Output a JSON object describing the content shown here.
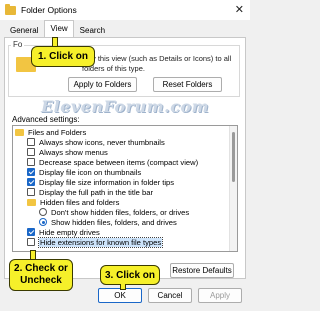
{
  "window": {
    "title": "Folder Options",
    "close_glyph": "✕"
  },
  "tabs": [
    {
      "label": "General",
      "active": false
    },
    {
      "label": "View",
      "active": true
    },
    {
      "label": "Search",
      "active": false
    }
  ],
  "folder_views": {
    "legend": "Fo",
    "description": "pply this view (such as Details or Icons) to all folders of this type.",
    "apply_button": "Apply to Folders",
    "reset_button": "Reset Folders"
  },
  "watermark": "ElevenForum.com",
  "advanced": {
    "label": "Advanced settings:",
    "items": [
      {
        "kind": "folder",
        "label": "Files and Folders",
        "indent": 0
      },
      {
        "kind": "checkbox",
        "label": "Always show icons, never thumbnails",
        "checked": false,
        "indent": 1
      },
      {
        "kind": "checkbox",
        "label": "Always show menus",
        "checked": false,
        "indent": 1
      },
      {
        "kind": "checkbox",
        "label": "Decrease space between items (compact view)",
        "checked": false,
        "indent": 1
      },
      {
        "kind": "checkbox",
        "label": "Display file icon on thumbnails",
        "checked": true,
        "indent": 1
      },
      {
        "kind": "checkbox",
        "label": "Display file size information in folder tips",
        "checked": true,
        "indent": 1
      },
      {
        "kind": "checkbox",
        "label": "Display the full path in the title bar",
        "checked": false,
        "indent": 1
      },
      {
        "kind": "folder",
        "label": "Hidden files and folders",
        "indent": 1
      },
      {
        "kind": "radio",
        "label": "Don't show hidden files, folders, or drives",
        "checked": false,
        "indent": 2
      },
      {
        "kind": "radio",
        "label": "Show hidden files, folders, and drives",
        "checked": true,
        "indent": 2
      },
      {
        "kind": "checkbox",
        "label": "Hide empty drives",
        "checked": true,
        "indent": 1
      },
      {
        "kind": "checkbox",
        "label": "Hide extensions for known file types",
        "checked": false,
        "indent": 1,
        "highlighted": true
      }
    ]
  },
  "buttons": {
    "restore_defaults": "Restore Defaults",
    "ok": "OK",
    "cancel": "Cancel",
    "apply": "Apply"
  },
  "callouts": {
    "step1": "1. Click on",
    "step2_line1": "2. Check or",
    "step2_line2": "Uncheck",
    "step3": "3. Click on"
  },
  "colors": {
    "callout": "#f6f02a",
    "accent": "#1a67c8",
    "highlight": "#cde4fb"
  }
}
